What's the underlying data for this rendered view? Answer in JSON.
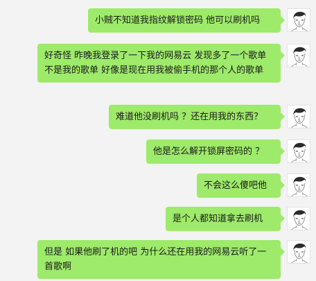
{
  "chat": {
    "messages": [
      {
        "text": "小贼不知道我指纹解锁密码 他可以刷机吗",
        "avatar_icon": "user-portrait-sketch-icon"
      },
      {
        "text": "好奇怪 昨晚我登录了一下我的网易云 发现多了一个歌单 不是我的歌单 好像是现在用我被偷手机的那个人的歌单",
        "avatar_icon": "user-portrait-sketch-icon"
      },
      {
        "text": "难道他没刷机吗 ？还在用我的东西？",
        "avatar_icon": "user-portrait-sketch-icon"
      },
      {
        "text": "他是怎么解开锁屏密码的 ？",
        "avatar_icon": "user-portrait-sketch-icon"
      },
      {
        "text": "不会这么傻吧他",
        "avatar_icon": "user-portrait-sketch-icon"
      },
      {
        "text": "是个人都知道拿去刷机",
        "avatar_icon": "user-portrait-sketch-icon"
      },
      {
        "text": "但是 如果他刷了机的吧 为什么还在用我的网易云听了一首歌啊",
        "avatar_icon": "user-portrait-sketch-icon"
      }
    ]
  },
  "colors": {
    "background": "#f3f3f3",
    "bubble": "#9eea6a",
    "text": "#1b1b1b"
  }
}
